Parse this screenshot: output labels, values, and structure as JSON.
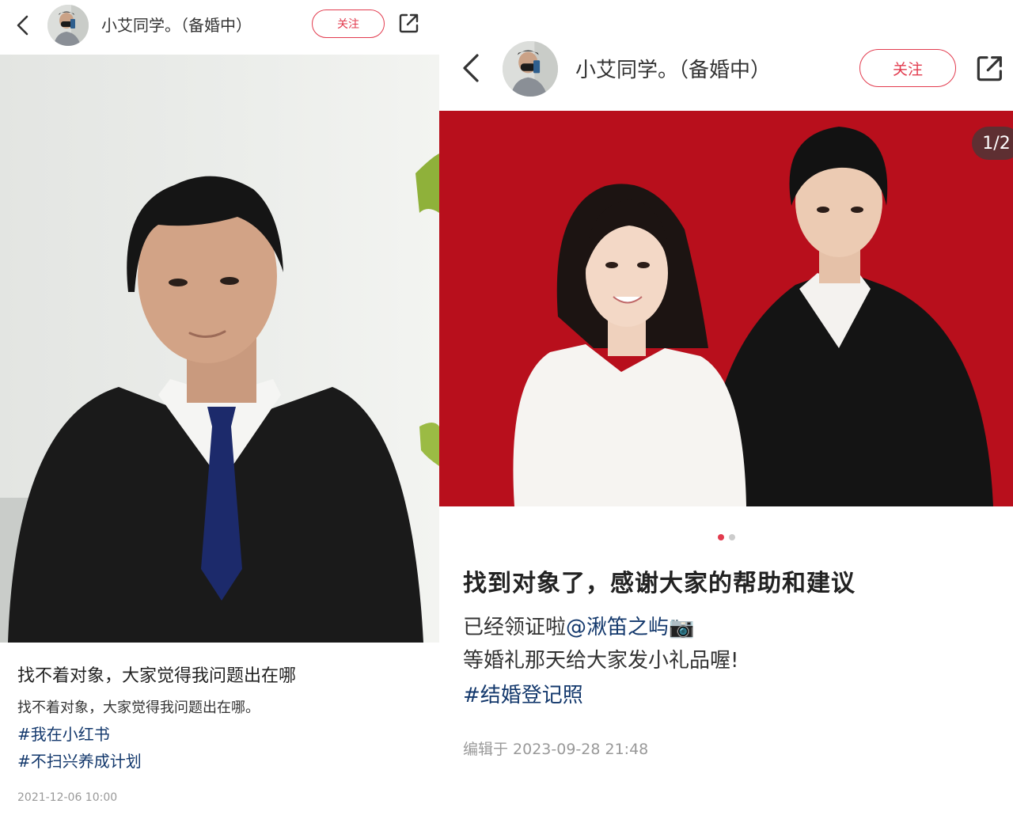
{
  "left": {
    "author_name": "小艾同学。（备婚中）",
    "follow_label": "关注",
    "title": "找不着对象，大家觉得我问题出在哪",
    "body": "找不着对象，大家觉得我问题出在哪。",
    "tags": [
      "#我在小红书",
      "#不扫兴养成计划"
    ],
    "date": "2021-12-06 10:00"
  },
  "right": {
    "author_name": "小艾同学。（备婚中）",
    "follow_label": "关注",
    "image_counter": "1/2",
    "title": "找到对象了，感谢大家的帮助和建议",
    "body_line1_prefix": "已经领证啦",
    "mention": "@湫笛之屿",
    "camera_emoji": "📷",
    "body_line2": "等婚礼那天给大家发小礼品喔!",
    "tag": "#结婚登记照",
    "date": "编辑于 2023-09-28 21:48"
  },
  "colors": {
    "accent": "#e23b4e",
    "tag": "#13386c",
    "photo_backdrop": "#b80f1c"
  },
  "icons": [
    "back-arrow-icon",
    "share-icon"
  ]
}
